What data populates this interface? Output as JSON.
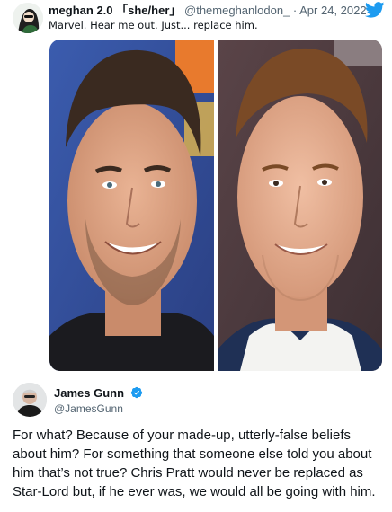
{
  "quoted_tweet": {
    "author_name": "meghan 2.0 「she/her」",
    "handle_date": "@themeghanlodon_ · Apr 24, 2022",
    "text": "Marvel. Hear me out. Just... replace him.",
    "images": [
      {
        "icon": "photo-of-smiling-man-left"
      },
      {
        "icon": "photo-of-smiling-man-right"
      }
    ],
    "colors": {
      "twitter_blue": "#1d9bf0"
    }
  },
  "reply_tweet": {
    "author_name": "James Gunn",
    "handle": "@JamesGunn",
    "verified": true,
    "text": "For what? Because of your made-up, utterly-false beliefs about him? For something that someone else told you about him that’s not true? Chris Pratt would never be replaced as Star-Lord but, if he ever was, we would all be going with him."
  }
}
